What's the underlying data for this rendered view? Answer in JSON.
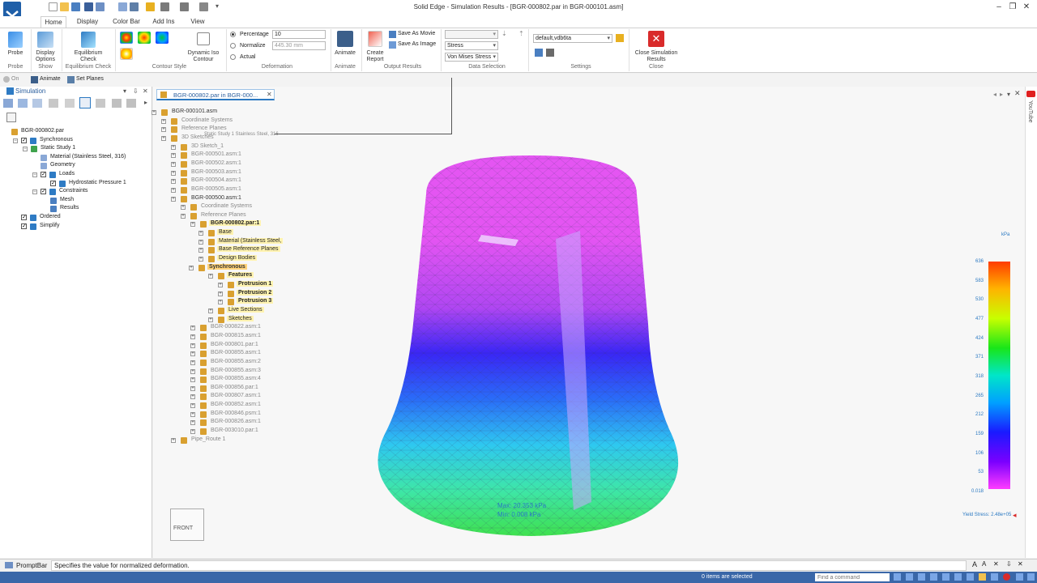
{
  "window": {
    "title": "Solid Edge - Simulation Results - [BGR-000802.par in BGR-000101.asm]"
  },
  "ribbon": {
    "tabs": [
      "Home",
      "Display",
      "Color Bar",
      "Add Ins",
      "View"
    ],
    "active_tab": "Home",
    "probe": {
      "label": "Probe",
      "group": "Probe"
    },
    "display_options": {
      "label1": "Display",
      "label2": "Options",
      "group": "Show"
    },
    "equilibrium": {
      "label1": "Equilibrium",
      "label2": "Check",
      "group": "Equilibrium Check"
    },
    "contour_group": "Contour Style",
    "dynamic_iso": {
      "label1": "Dynamic Iso",
      "label2": "Contour"
    },
    "deformation": {
      "group": "Deformation",
      "percentage_label": "Percentage",
      "percentage_value": "10",
      "normalize_label": "Normalize",
      "normalize_value": "445.30 mm",
      "actual_label": "Actual"
    },
    "animate": {
      "label": "Animate",
      "group": "Animate"
    },
    "create_report": {
      "label1": "Create",
      "label2": "Report"
    },
    "save_as_movie": "Save As Movie",
    "save_as_image": "Save As Image",
    "output_group": "Output Results",
    "data_selection": {
      "group": "Data Selection",
      "select1": "Stress",
      "select2": "Von Mises Stress"
    },
    "settings": {
      "group": "Settings",
      "value": "default,vdb6ta"
    },
    "close_sim": {
      "label1": "Close Simulation",
      "label2": "Results",
      "group": "Close"
    }
  },
  "subbar": {
    "on_label": "On",
    "animate_label": "Animate",
    "set_planes_label": "Set Planes"
  },
  "left_panel": {
    "title": "Simulation",
    "tree": [
      {
        "label": "BGR-000802.par",
        "level": 0
      },
      {
        "label": "Synchronous",
        "level": 1
      },
      {
        "label": "Static Study 1",
        "level": 2
      },
      {
        "label": "Material (Stainless Steel, 316)",
        "level": 3
      },
      {
        "label": "Geometry",
        "level": 3
      },
      {
        "label": "Loads",
        "level": 3
      },
      {
        "label": "Hydrostatic Pressure 1",
        "level": 4
      },
      {
        "label": "Constraints",
        "level": 3
      },
      {
        "label": "Mesh",
        "level": 4
      },
      {
        "label": "Results",
        "level": 4
      },
      {
        "label": "Ordered",
        "level": 1
      },
      {
        "label": "Simplify",
        "level": 1
      }
    ]
  },
  "doc_tab": {
    "label": "BGR-000802.par in BGR-000..."
  },
  "nav_tree": [
    {
      "label": "BGR-000101.asm",
      "x": 6,
      "style": ""
    },
    {
      "label": "Coordinate Systems",
      "x": 18,
      "style": "dim"
    },
    {
      "label": "Reference Planes",
      "x": 18,
      "style": "dim"
    },
    {
      "label": "3D Sketches",
      "x": 18,
      "style": "dim"
    },
    {
      "label": "3D Sketch_1",
      "x": 30,
      "style": "dim"
    },
    {
      "label": "BGR-000501.asm:1",
      "x": 30,
      "style": "dim"
    },
    {
      "label": "BGR-000502.asm:1",
      "x": 30,
      "style": "dim"
    },
    {
      "label": "BGR-000503.asm:1",
      "x": 30,
      "style": "dim"
    },
    {
      "label": "BGR-000504.asm:1",
      "x": 30,
      "style": "dim"
    },
    {
      "label": "BGR-000505.asm:1",
      "x": 30,
      "style": "dim"
    },
    {
      "label": "BGR-000500.asm:1",
      "x": 30,
      "style": ""
    },
    {
      "label": "Coordinate Systems",
      "x": 42,
      "style": "dim"
    },
    {
      "label": "Reference Planes",
      "x": 42,
      "style": "dim"
    },
    {
      "label": "BGR-000802.par:1",
      "x": 54,
      "style": "hl bold"
    },
    {
      "label": "Base",
      "x": 64,
      "style": "hl"
    },
    {
      "label": "Material (Stainless Steel,",
      "x": 64,
      "style": "hl"
    },
    {
      "label": "Base Reference Planes",
      "x": 64,
      "style": "hl"
    },
    {
      "label": "Design Bodies",
      "x": 64,
      "style": "hl"
    },
    {
      "label": "Synchronous",
      "x": 52,
      "style": "hl2 bold"
    },
    {
      "label": "Features",
      "x": 76,
      "style": "hl bold"
    },
    {
      "label": "Protrusion 1",
      "x": 88,
      "style": "hl bold"
    },
    {
      "label": "Protrusion 2",
      "x": 88,
      "style": "hl bold"
    },
    {
      "label": "Protrusion 3",
      "x": 88,
      "style": "hl bold"
    },
    {
      "label": "Live Sections",
      "x": 76,
      "style": "hl"
    },
    {
      "label": "Sketches",
      "x": 76,
      "style": "hl"
    },
    {
      "label": "BGR-000822.asm:1",
      "x": 54,
      "style": "dim"
    },
    {
      "label": "BGR-000815.asm:1",
      "x": 54,
      "style": "dim"
    },
    {
      "label": "BGR-000801.par:1",
      "x": 54,
      "style": "dim"
    },
    {
      "label": "BGR-000855.asm:1",
      "x": 54,
      "style": "dim"
    },
    {
      "label": "BGR-000855.asm:2",
      "x": 54,
      "style": "dim"
    },
    {
      "label": "BGR-000855.asm:3",
      "x": 54,
      "style": "dim"
    },
    {
      "label": "BGR-000855.asm:4",
      "x": 54,
      "style": "dim"
    },
    {
      "label": "BGR-000856.par:1",
      "x": 54,
      "style": "dim"
    },
    {
      "label": "BGR-000807.asm:1",
      "x": 54,
      "style": "dim"
    },
    {
      "label": "BGR-000852.asm:1",
      "x": 54,
      "style": "dim"
    },
    {
      "label": "BGR-000846.psm:1",
      "x": 54,
      "style": "dim"
    },
    {
      "label": "BGR-000826.asm:1",
      "x": 54,
      "style": "dim"
    },
    {
      "label": "BGR-003010.par:1",
      "x": 54,
      "style": "dim"
    },
    {
      "label": "Pipe_Route 1",
      "x": 30,
      "style": "dim"
    }
  ],
  "model_overlay": {
    "max_text": "Max: 20.353 kPa",
    "min_text": "Min: 0.008 kPa",
    "tooltip_text": "Static Study 1 Stainless Steel, 316"
  },
  "view_cube": {
    "label": "FRONT"
  },
  "color_bar": {
    "unit": "kPa",
    "labels": [
      "636",
      "583",
      "530",
      "477",
      "424",
      "371",
      "318",
      "265",
      "212",
      "159",
      "106",
      "53",
      "0.018"
    ],
    "yield_text": "Yield Stress: 2.48e+05",
    "colors": {
      "top": "#ff3c00",
      "bottom": "#ff3cff"
    }
  },
  "right_strip": {
    "label": "YouTube"
  },
  "prompt_bar": {
    "label": "PromptBar",
    "message": "Specifies the value for normalized deformation."
  },
  "status_bar": {
    "selection": "0 items are selected",
    "find_placeholder": "Find a command"
  }
}
